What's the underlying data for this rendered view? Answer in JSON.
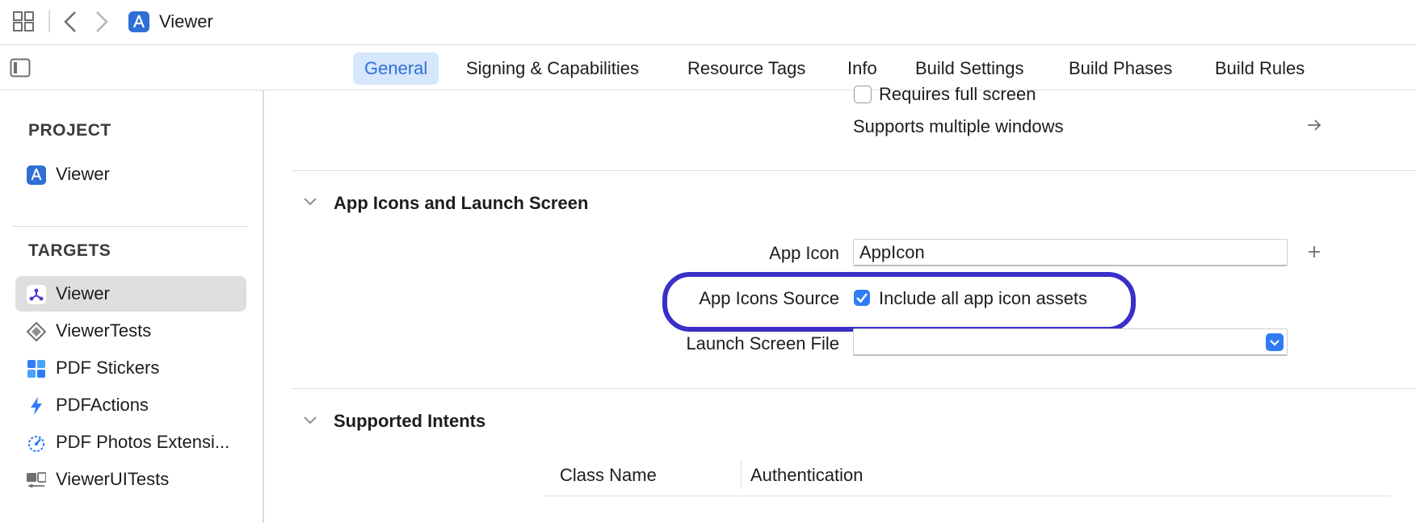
{
  "window": {
    "title": "Viewer"
  },
  "tabs": [
    {
      "label": "General",
      "active": true
    },
    {
      "label": "Signing & Capabilities"
    },
    {
      "label": "Resource Tags"
    },
    {
      "label": "Info"
    },
    {
      "label": "Build Settings"
    },
    {
      "label": "Build Phases"
    },
    {
      "label": "Build Rules"
    }
  ],
  "sidebar": {
    "project_title": "PROJECT",
    "project_items": [
      {
        "label": "Viewer",
        "icon": "app-project-icon"
      }
    ],
    "targets_title": "TARGETS",
    "target_items": [
      {
        "label": "Viewer",
        "icon": "app-target-icon",
        "selected": true
      },
      {
        "label": "ViewerTests",
        "icon": "unit-test-icon"
      },
      {
        "label": "PDF Stickers",
        "icon": "sticker-pack-icon"
      },
      {
        "label": "PDFActions",
        "icon": "action-extension-icon"
      },
      {
        "label": "PDF Photos Extensi...",
        "icon": "photo-extension-icon"
      },
      {
        "label": "ViewerUITests",
        "icon": "ui-test-icon"
      }
    ]
  },
  "deployment": {
    "requires_full_screen": "Requires full screen",
    "supports_multiple_windows": "Supports multiple windows"
  },
  "app_icons_section": {
    "title": "App Icons and Launch Screen",
    "app_icon_label": "App Icon",
    "app_icon_value": "AppIcon",
    "icons_source_label": "App Icons Source",
    "include_all_label": "Include all app icon assets",
    "launch_screen_label": "Launch Screen File",
    "launch_screen_value": ""
  },
  "intents_section": {
    "title": "Supported Intents",
    "columns": [
      "Class Name",
      "Authentication"
    ]
  },
  "colors": {
    "accent": "#2f7cf6",
    "highlight": "#3a2fc8",
    "selected_tab_bg": "#d6e6fb"
  }
}
